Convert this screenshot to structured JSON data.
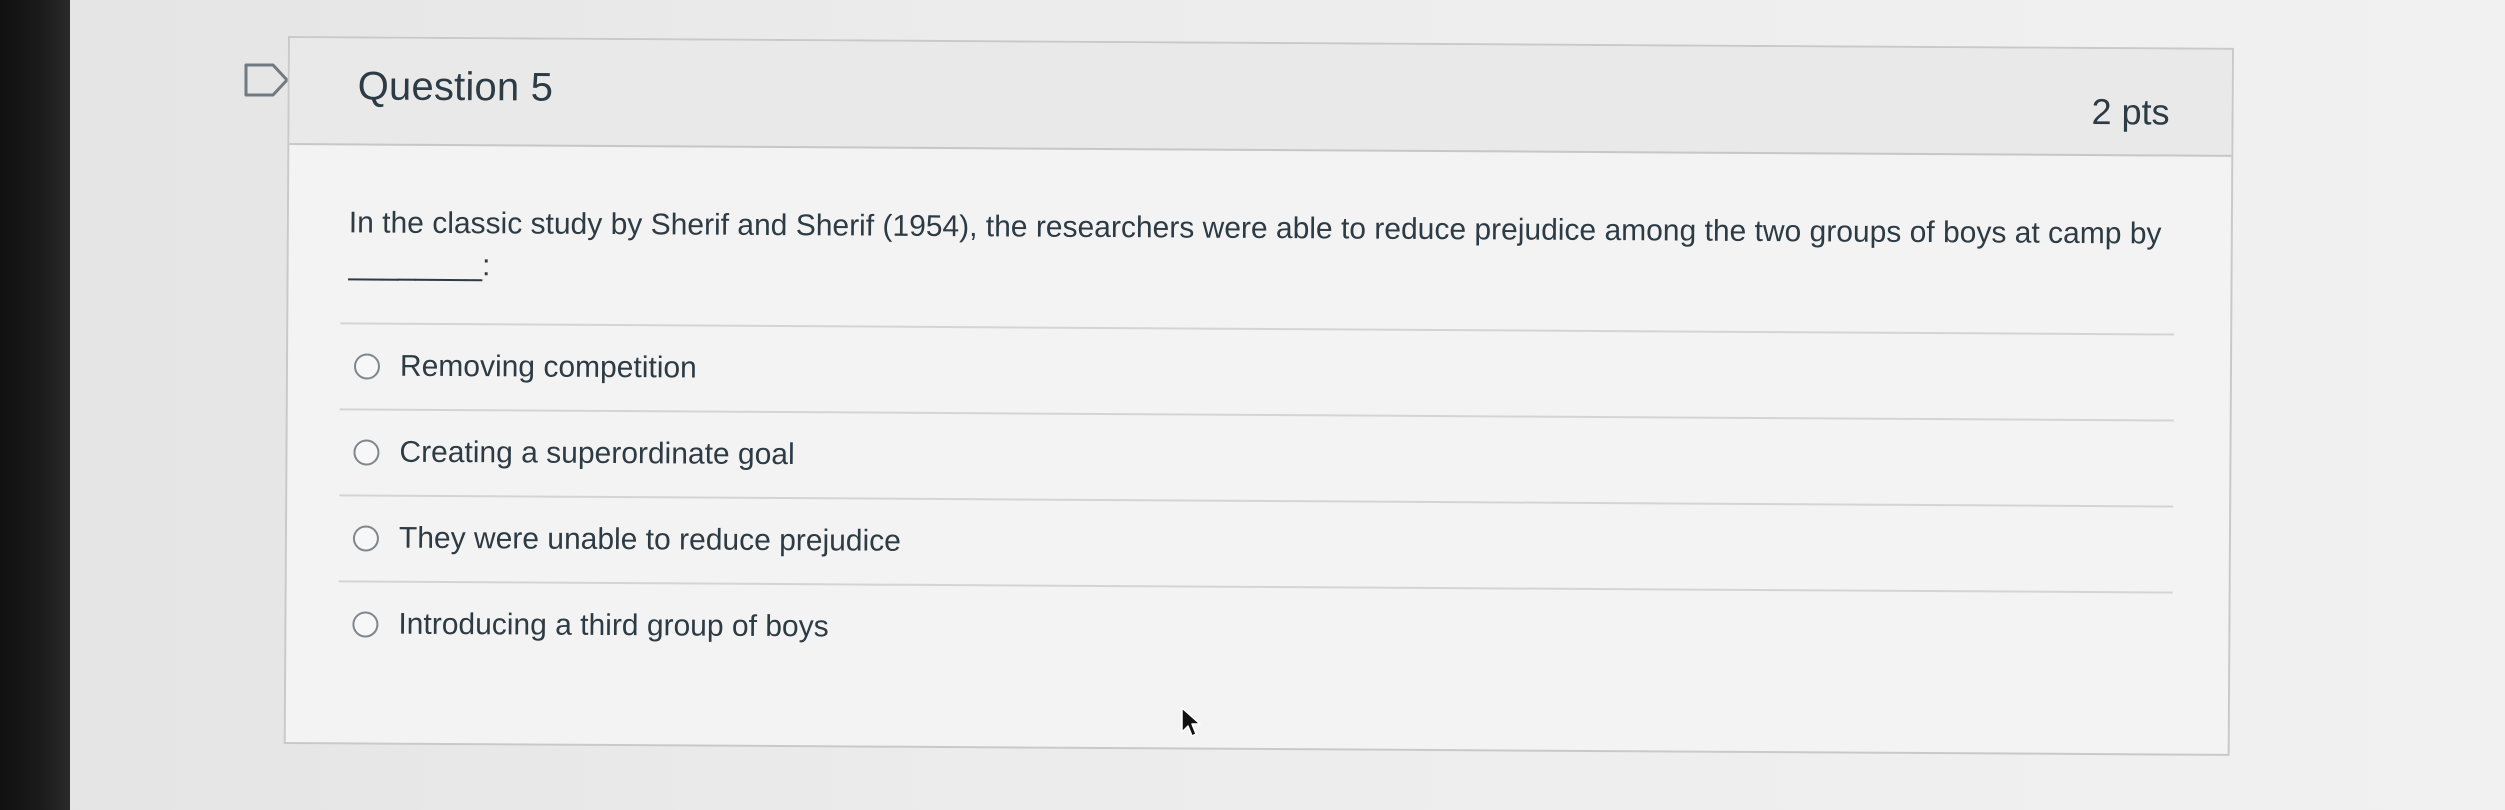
{
  "question": {
    "title": "Question 5",
    "points": "2 pts",
    "text": "In the classic study by Sherif and Sherif (1954), the researchers were able to reduce prejudice among the two groups of boys at camp by ________:"
  },
  "answers": [
    {
      "label": "Removing competition"
    },
    {
      "label": "Creating a superordinate goal"
    },
    {
      "label": "They were unable to reduce prejudice"
    },
    {
      "label": "Introducing a third group of boys"
    }
  ],
  "icons": {
    "bookmark": "bookmark-flag-icon",
    "cursor": "mouse-pointer-icon"
  },
  "colors": {
    "text": "#2d3b45",
    "header_bg": "#e9e9e9",
    "card_bg": "#f3f3f3",
    "border": "#c9c9c9"
  }
}
